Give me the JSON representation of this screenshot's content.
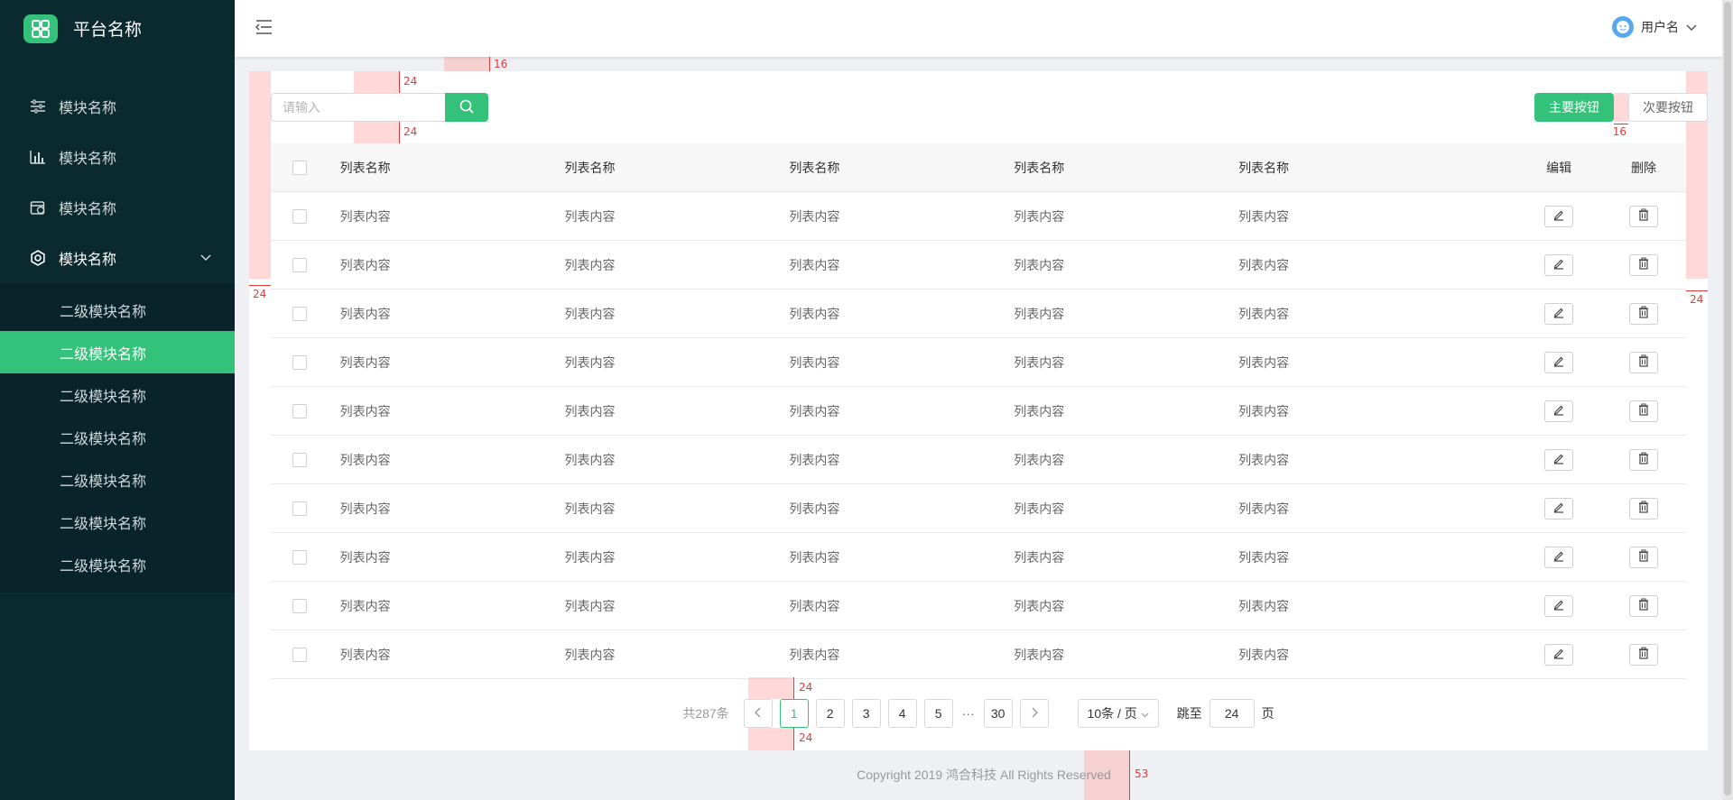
{
  "sidebar": {
    "platform_name": "平台名称",
    "items": [
      {
        "label": "模块名称",
        "icon": "sliders-icon"
      },
      {
        "label": "模块名称",
        "icon": "bar-chart-icon"
      },
      {
        "label": "模块名称",
        "icon": "calendar-icon"
      },
      {
        "label": "模块名称",
        "icon": "gear-icon",
        "expanded": true
      }
    ],
    "subitems": [
      "二级模块名称",
      "二级模块名称",
      "二级模块名称",
      "二级模块名称",
      "二级模块名称",
      "二级模块名称",
      "二级模块名称"
    ],
    "active_subitem_index": 1
  },
  "header": {
    "user_name": "用户名"
  },
  "toolbar": {
    "search_placeholder": "请输入",
    "primary_button": "主要按钮",
    "secondary_button": "次要按钮"
  },
  "table": {
    "headers": [
      "列表名称",
      "列表名称",
      "列表名称",
      "列表名称",
      "列表名称"
    ],
    "edit_header": "编辑",
    "delete_header": "删除",
    "cell_text": "列表内容",
    "row_count": 10
  },
  "pagination": {
    "total": "共287条",
    "pages": [
      "1",
      "2",
      "3",
      "4",
      "5"
    ],
    "ellipsis": "···",
    "last_page": "30",
    "current_page": "1",
    "page_size": "10条 / 页",
    "jump_label": "跳至",
    "jump_value": "24",
    "page_suffix": "页"
  },
  "footer": {
    "copyright": "Copyright  2019 鸿合科技 All Rights Reserved"
  },
  "annotations": {
    "v24": "24",
    "v16": "16",
    "v53": "53"
  },
  "colors": {
    "sidebar_bg": "#0b2a30",
    "accent": "#34c27a",
    "annotation": "#e03a3a"
  }
}
